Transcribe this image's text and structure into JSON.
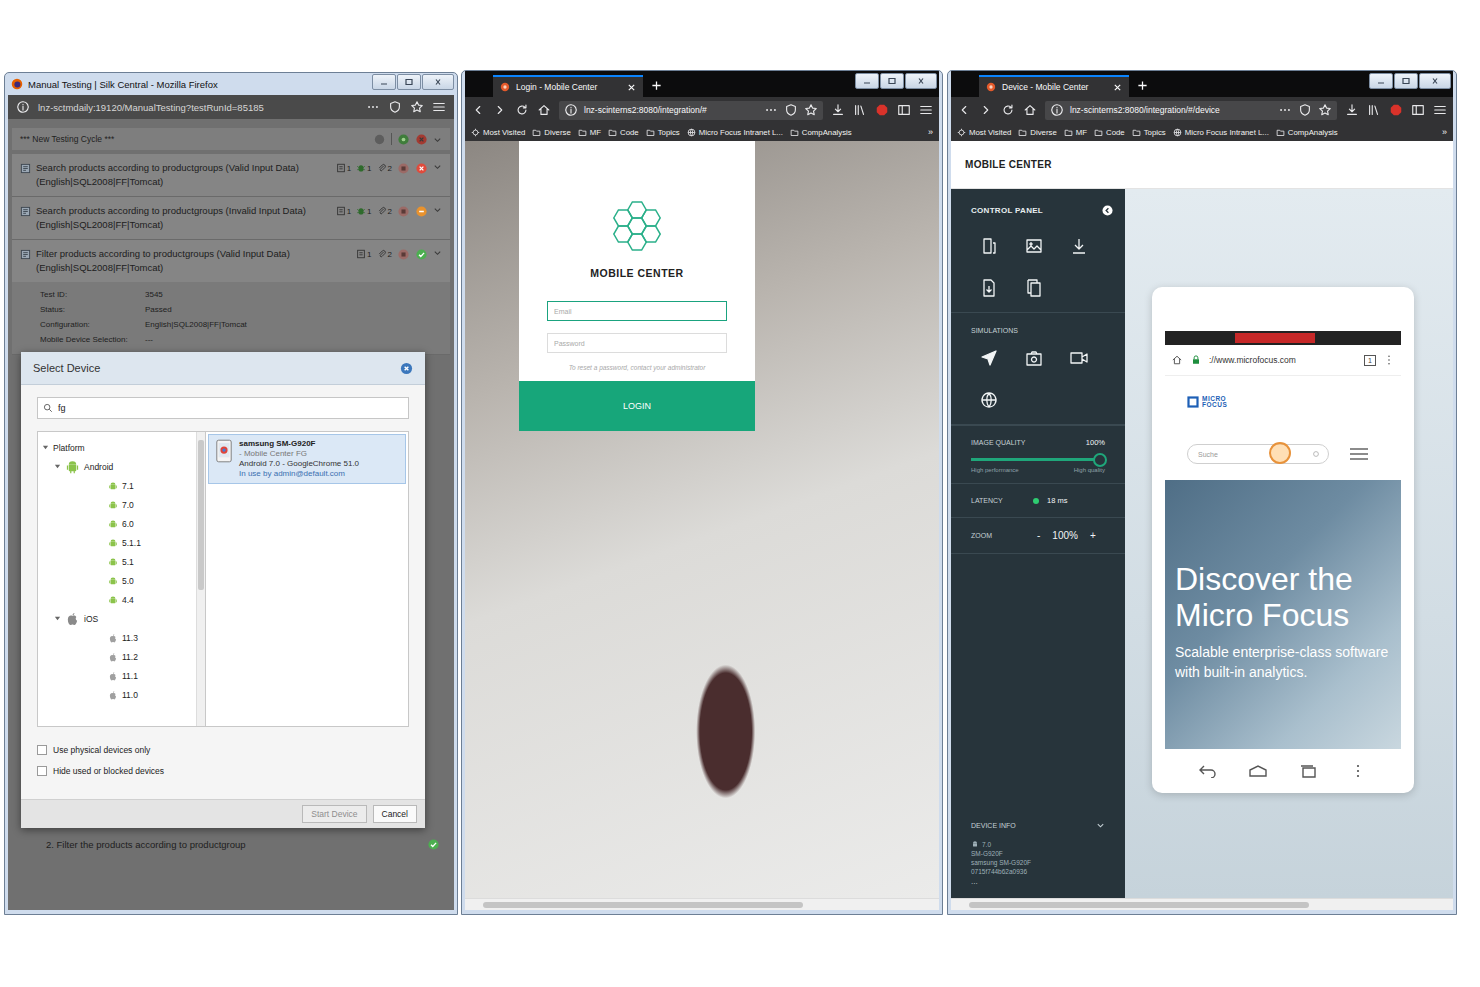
{
  "silk": {
    "title": "Manual Testing | Silk Central - Mozilla Firefox",
    "url": "lnz-sctmdaily:19120/ManualTesting?testRunId=85185",
    "cycle": "*** New Testing Cycle ***",
    "tests": [
      {
        "name": "Search products according to productgroups (Valid Input Data) (English|SQL2008|FF|Tomcat)",
        "badges": [
          {
            "kind": "result",
            "count": "1"
          },
          {
            "kind": "defect",
            "count": "1"
          },
          {
            "kind": "attachment",
            "count": "2"
          }
        ],
        "kind": "failed",
        "color": "#e04b3c",
        "expanded": false,
        "details": []
      },
      {
        "name": "Search products according to productgroups (Invalid Input Data) (English|SQL2008|FF|Tomcat)",
        "badges": [
          {
            "kind": "result",
            "count": "1"
          },
          {
            "kind": "defect",
            "count": "1"
          },
          {
            "kind": "attachment",
            "count": "2"
          }
        ],
        "kind": "blocked",
        "color": "#e8922e",
        "expanded": false,
        "details": []
      },
      {
        "name": "Filter products according to productgroups (Valid Input Data) (English|SQL2008|FF|Tomcat)",
        "badges": [
          {
            "kind": "result",
            "count": "1"
          },
          {
            "kind": "attachment",
            "count": "2"
          }
        ],
        "kind": "passed",
        "color": "#4caf50",
        "expanded": true,
        "details": [
          {
            "label": "Test ID:",
            "value": "3545"
          },
          {
            "label": "Status:",
            "value": "Passed"
          },
          {
            "label": "Configuration:",
            "value": "English|SQL2008|FF|Tomcat"
          },
          {
            "label": "Mobile Device Selection:",
            "value": "---"
          }
        ]
      }
    ],
    "step": {
      "text": "2. Filter the products according to productgroup",
      "color": "#4caf50"
    },
    "dialog": {
      "title": "Select Device",
      "search": "fg",
      "tree": {
        "root": "Platform",
        "expanded": true,
        "platforms": [
          {
            "name": "Android",
            "kind": "android",
            "expanded": true,
            "versions": [
              "7.1",
              "7.0",
              "6.0",
              "5.1.1",
              "5.1",
              "5.0",
              "4.4"
            ]
          },
          {
            "name": "iOS",
            "kind": "ios",
            "expanded": true,
            "versions": [
              "11.3",
              "11.2",
              "11.1",
              "11.0"
            ]
          }
        ]
      },
      "devices": [
        {
          "name": "samsung SM-G920F",
          "group": "- Mobile Center FG",
          "os": "Android 7.0 - GoogleChrome 51.0",
          "usage": "In use by admin@default.com",
          "selected": true
        }
      ],
      "options": [
        {
          "label": "Use physical devices only",
          "checked": false
        },
        {
          "label": "Hide used or blocked devices",
          "checked": false
        }
      ],
      "buttons": [
        {
          "label": "Start Device",
          "disabled": true
        },
        {
          "label": "Cancel",
          "disabled": false
        }
      ]
    }
  },
  "bookmarks": {
    "items": [
      {
        "label": "Most Visited",
        "kind": "gear"
      },
      {
        "label": "Diverse",
        "kind": "folder"
      },
      {
        "label": "MF",
        "kind": "folder"
      },
      {
        "label": "Code",
        "kind": "folder"
      },
      {
        "label": "Topics",
        "kind": "folder"
      },
      {
        "label": "Micro Focus Intranet L...",
        "kind": "globe"
      },
      {
        "label": "CompAnalysis",
        "kind": "folder"
      }
    ],
    "more": "»"
  },
  "browsers": [
    {
      "kind": "login",
      "tab": "Login - Mobile Center",
      "url": "lnz-scinterns2:8080/integration/#"
    },
    {
      "kind": "device",
      "tab": "Device - Mobile Center",
      "url": "lnz-scinterns2:8080/integration/#/device"
    }
  ],
  "login": {
    "product": "MOBILE CENTER",
    "email_placeholder": "Email",
    "password_placeholder": "Password",
    "hint": "To reset a password, contact your administrator",
    "button": "LOGIN"
  },
  "device": {
    "brand": "MOBILE CENTER",
    "panel_title": "CONTROL PANEL",
    "simulations": "SIMULATIONS",
    "quality": {
      "label": "IMAGE QUALITY",
      "reading": "100%",
      "level": 1,
      "low": "High performance",
      "high": "High quality"
    },
    "latency": {
      "label": "LATENCY",
      "reading": "18 ms"
    },
    "zoom": {
      "label": "ZOOM",
      "minus": "-",
      "reading": "100%",
      "plus": "+"
    },
    "info": {
      "title": "DEVICE INFO",
      "expanded": true,
      "os": "7.0",
      "lines": [
        "SM-G920F",
        "samsung SM-G920F",
        "0715f744b62a0936"
      ],
      "more": "..."
    },
    "phone": {
      "url": "://www.microfocus.com",
      "tab_count": "1",
      "logo": [
        "MICRO",
        "FOCUS"
      ],
      "search": "Suche",
      "headline": "Discover the Micro Focus",
      "tagline": "Scalable enterprise-class software with built-in analytics."
    }
  }
}
